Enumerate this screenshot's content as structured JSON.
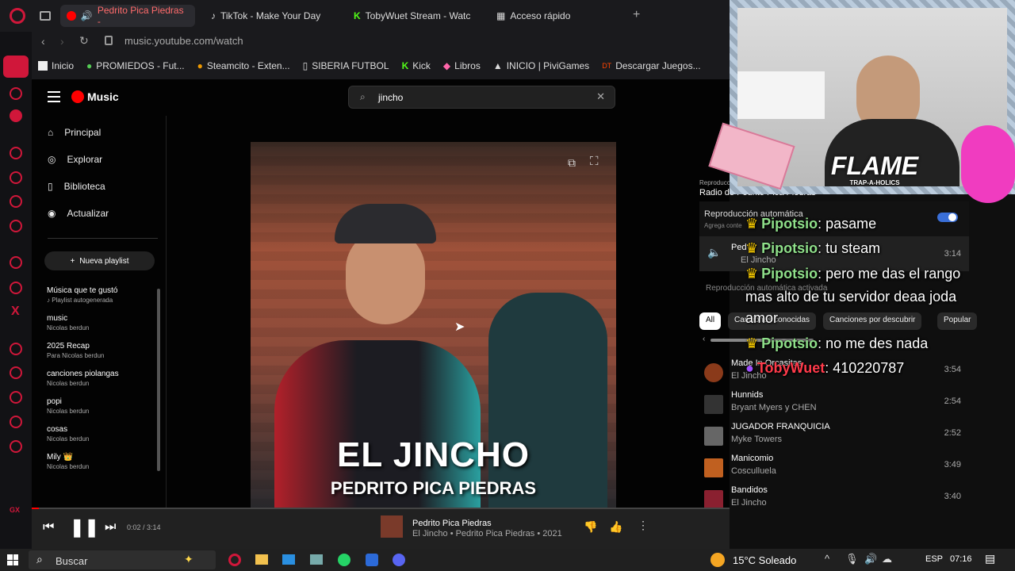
{
  "browser": {
    "tabs": [
      {
        "label": "Pedrito Pica Piedras -",
        "active": true
      },
      {
        "label": "TikTok - Make Your Day",
        "active": false
      },
      {
        "label": "TobyWuet Stream - Watc",
        "active": false
      },
      {
        "label": "Acceso rápido",
        "active": false
      }
    ],
    "url_host": "music.youtube.com/watch",
    "bookmarks": [
      "Inicio",
      "PROMIEDOS - Fut...",
      "Steamcito - Exten...",
      "SIBERIA FUTBOL",
      "Kick",
      "Libros",
      "INICIO | PiviGames",
      "Descargar Juegos..."
    ]
  },
  "ytm": {
    "logo": "Music",
    "search_value": "jincho",
    "nav": [
      "Principal",
      "Explorar",
      "Biblioteca",
      "Actualizar"
    ],
    "new_playlist": "Nueva playlist",
    "playlists": [
      {
        "title": "Música que te gustó",
        "sub": "♪ Playlist autogenerada"
      },
      {
        "title": "music",
        "sub": "Nicolas berdun"
      },
      {
        "title": "2025 Recap",
        "sub": "Para Nicolas berdun"
      },
      {
        "title": "canciones piolangas",
        "sub": "Nicolas berdun"
      },
      {
        "title": "popi",
        "sub": "Nicolas berdun"
      },
      {
        "title": "cosas",
        "sub": "Nicolas berdun"
      },
      {
        "title": "Mily 👑",
        "sub": "Nicolas berdun"
      }
    ],
    "video": {
      "title_line1": "EL JINCHO",
      "title_line2": "PEDRITO PICA PIEDRAS"
    },
    "panel": {
      "reproduccion": "Reproduccion",
      "radio": "Radio de Pedrito Pica Piedras",
      "autoplay_label": "Reproducción automática",
      "autoplay_sub": "Agrega conte",
      "current": {
        "title": "Ped",
        "artist": "El Jincho",
        "duration": "3:14"
      },
      "autoplay_active": "Reproducción automática activada",
      "chips": [
        "All",
        "Canciones conocidas",
        "Canciones por descubrir",
        "Popular"
      ],
      "queue": [
        {
          "title": "Made In Orcasitas",
          "artist": "El Jincho",
          "duration": "3:54",
          "color": "#8a3a1a"
        },
        {
          "title": "Hunnids",
          "artist": "Bryant Myers y CHEN",
          "duration": "2:54",
          "color": "#333"
        },
        {
          "title": "JUGADOR FRANQUICIA",
          "artist": "Myke Towers",
          "duration": "2:52",
          "color": "#666"
        },
        {
          "title": "Manicomio",
          "artist": "Cosculluela",
          "duration": "3:49",
          "color": "#c06020"
        },
        {
          "title": "Bandidos",
          "artist": "El Jincho",
          "duration": "3:40",
          "color": "#8a2030"
        }
      ]
    },
    "player": {
      "time": "0:02 / 3:14",
      "title": "Pedrito Pica Piedras",
      "meta": "El Jincho • Pedrito Pica Piedras • 2021"
    }
  },
  "overlay": {
    "banner_text": "FLAME",
    "banner_sub": "TRAP-A-HOLICS",
    "chat": [
      {
        "user": "Pipotsio",
        "msg": ": pasame",
        "crown": true
      },
      {
        "user": "Pipotsio",
        "msg": ": tu steam",
        "crown": true
      },
      {
        "user": "Pipotsio",
        "msg": ": pero me das el rango",
        "crown": true
      },
      {
        "user": "",
        "msg": "mas alto de tu servidor deaa joda",
        "crown": false
      },
      {
        "user": "",
        "msg": "amor",
        "crown": false
      },
      {
        "user": "Pipotsio",
        "msg": ": no me des nada",
        "crown": true
      },
      {
        "user": "TobyWuet",
        "msg": ": 410220787",
        "crown": false
      }
    ]
  },
  "taskbar": {
    "search_placeholder": "Buscar",
    "weather": "15°C  Soleado",
    "lang": "ESP",
    "clock": "07:16"
  }
}
